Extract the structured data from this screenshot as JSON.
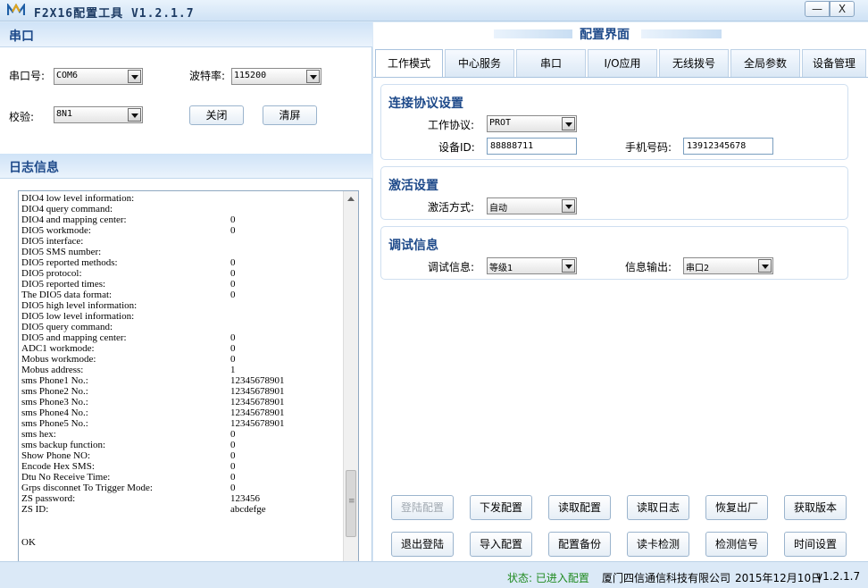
{
  "window": {
    "title": "F2X16配置工具 V1.2.1.7",
    "minimize": "—",
    "close": "X"
  },
  "serial": {
    "header": "串口",
    "port_label": "串口号:",
    "port_value": "COM6",
    "baud_label": "波特率:",
    "baud_value": "115200",
    "check_label": "校验:",
    "check_value": "8N1",
    "close_button": "关闭",
    "clear_button": "清屏"
  },
  "log": {
    "header": "日志信息",
    "lines": [
      {
        "k": "DIO4 low level information:",
        "v": ""
      },
      {
        "k": "DIO4 query command:",
        "v": ""
      },
      {
        "k": "DIO4 and mapping center:",
        "v": "0"
      },
      {
        "k": "DIO5 workmode:",
        "v": "0"
      },
      {
        "k": "DIO5 interface:",
        "v": ""
      },
      {
        "k": "DIO5 SMS number:",
        "v": ""
      },
      {
        "k": "DIO5 reported methods:",
        "v": "0"
      },
      {
        "k": "DIO5 protocol:",
        "v": "0"
      },
      {
        "k": "DIO5 reported times:",
        "v": "0"
      },
      {
        "k": "The DIO5 data format:",
        "v": "0"
      },
      {
        "k": "DIO5 high level information:",
        "v": ""
      },
      {
        "k": "DIO5 low level information:",
        "v": ""
      },
      {
        "k": "DIO5 query command:",
        "v": ""
      },
      {
        "k": "DIO5 and mapping center:",
        "v": "0"
      },
      {
        "k": "ADC1 workmode:",
        "v": "0"
      },
      {
        "k": "Mobus workmode:",
        "v": "0"
      },
      {
        "k": "Mobus address:",
        "v": "1"
      },
      {
        "k": "sms Phone1 No.:",
        "v": "12345678901"
      },
      {
        "k": "sms Phone2 No.:",
        "v": "12345678901"
      },
      {
        "k": "sms Phone3 No.:",
        "v": "12345678901"
      },
      {
        "k": "sms Phone4 No.:",
        "v": "12345678901"
      },
      {
        "k": "sms Phone5 No.:",
        "v": "12345678901"
      },
      {
        "k": "sms hex:",
        "v": "0"
      },
      {
        "k": "sms backup function:",
        "v": "0"
      },
      {
        "k": "Show Phone NO:",
        "v": "0"
      },
      {
        "k": "Encode Hex SMS:",
        "v": "0"
      },
      {
        "k": "Dtu No Receive Time:",
        "v": "0"
      },
      {
        "k": "Grps disconnet To Trigger Mode:",
        "v": "0"
      },
      {
        "k": "ZS password:",
        "v": "123456"
      },
      {
        "k": "ZS ID:",
        "v": "abcdefge"
      }
    ],
    "status": "OK"
  },
  "config": {
    "title": "配置界面",
    "tabs": [
      "工作模式",
      "中心服务",
      "串口",
      "I/O应用",
      "无线拨号",
      "全局参数",
      "设备管理"
    ],
    "connection": {
      "title": "连接协议设置",
      "protocol_label": "工作协议:",
      "protocol_value": "PROT",
      "device_id_label": "设备ID:",
      "device_id_value": "88888711",
      "phone_label": "手机号码:",
      "phone_value": "13912345678"
    },
    "activation": {
      "title": "激活设置",
      "mode_label": "激活方式:",
      "mode_value": "自动"
    },
    "debug": {
      "title": "调试信息",
      "level_label": "调试信息:",
      "level_value": "等级1",
      "output_label": "信息输出:",
      "output_value": "串口2"
    }
  },
  "actions": [
    "登陆配置",
    "下发配置",
    "读取配置",
    "读取日志",
    "恢复出厂",
    "获取版本",
    "退出登陆",
    "导入配置",
    "配置备份",
    "读卡检测",
    "检测信号",
    "时间设置"
  ],
  "status_bar": {
    "state": "状态: 已进入配置",
    "company": "厦门四信通信科技有限公司",
    "date": "2015年12月10日",
    "version": "v1.2.1.7"
  }
}
